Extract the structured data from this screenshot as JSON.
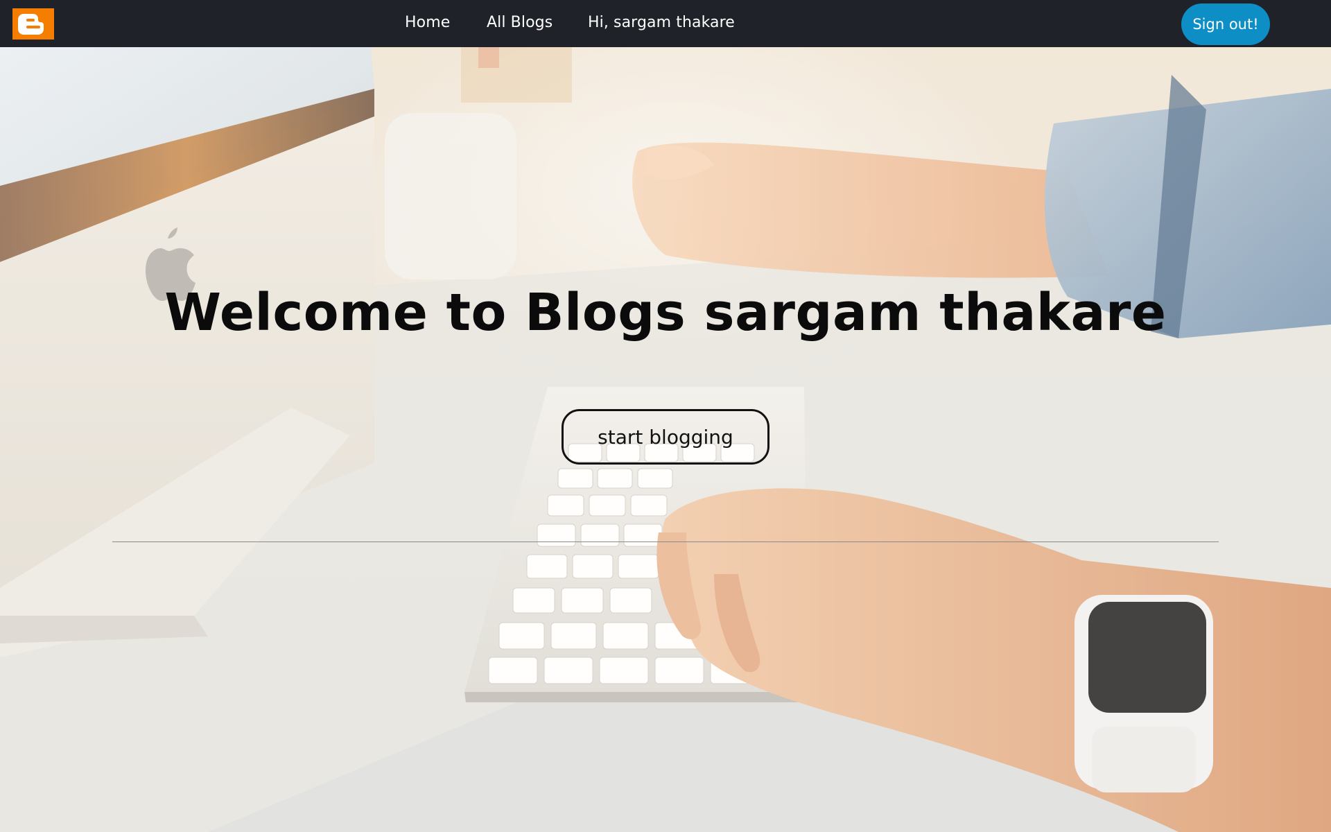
{
  "navbar": {
    "logo_icon": "blogger-logo-icon",
    "links": {
      "home": "Home",
      "all_blogs": "All Blogs"
    },
    "greeting": "Hi, sargam thakare",
    "sign_out_label": "Sign out!"
  },
  "hero": {
    "title": "Welcome to Blogs sargam thakare",
    "cta_label": "start blogging"
  },
  "colors": {
    "navbar_bg": "#1f2228",
    "logo_orange": "#f57d00",
    "sign_out_blue": "#0d8fc6",
    "text_dark": "#0b0b0b"
  }
}
